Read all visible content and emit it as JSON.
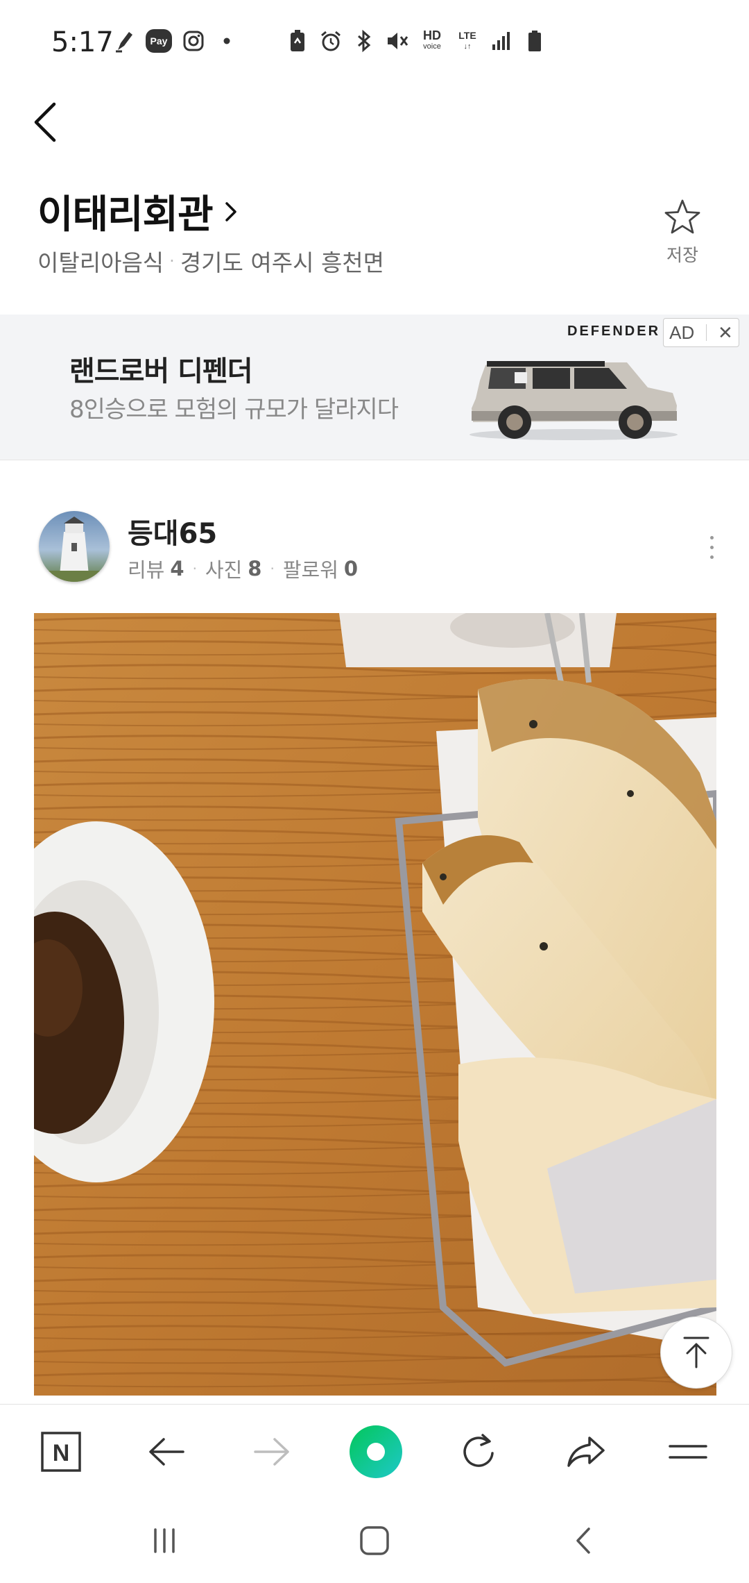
{
  "status_bar": {
    "time": "5:17",
    "left_icons": [
      "pen-icon",
      "pay-icon",
      "instagram-icon",
      "dot-icon"
    ],
    "pay_label": "Pay",
    "right_icons": [
      "battery-saver-icon",
      "alarm-icon",
      "bluetooth-icon",
      "mute-icon",
      "hd-voice-icon",
      "lte-icon",
      "signal-icon",
      "battery-icon"
    ],
    "hd_label": "HD",
    "hd_sub": "voice",
    "lte_label": "LTE"
  },
  "header": {
    "title": "이태리회관",
    "category": "이탈리아음식",
    "location": "경기도 여주시 흥천면",
    "save_label": "저장"
  },
  "ad": {
    "title": "랜드로버 디펜더",
    "description": "8인승으로 모험의 규모가 달라지다",
    "brand": "DEFENDER",
    "badge": "AD"
  },
  "review": {
    "reviewer_name": "등대65",
    "stats": [
      {
        "label": "리뷰",
        "value": "4"
      },
      {
        "label": "사진",
        "value": "8"
      },
      {
        "label": "팔로워",
        "value": "0"
      }
    ]
  },
  "toolbar": {
    "items": [
      "naver-home-icon",
      "back-arrow-icon",
      "forward-arrow-icon",
      "green-dot-icon",
      "refresh-icon",
      "share-icon",
      "menu-icon"
    ],
    "naver_letter": "N"
  },
  "colors": {
    "accent_green": "#03c75a",
    "accent_teal": "#1ec8c8",
    "ad_background": "#f3f4f6"
  }
}
